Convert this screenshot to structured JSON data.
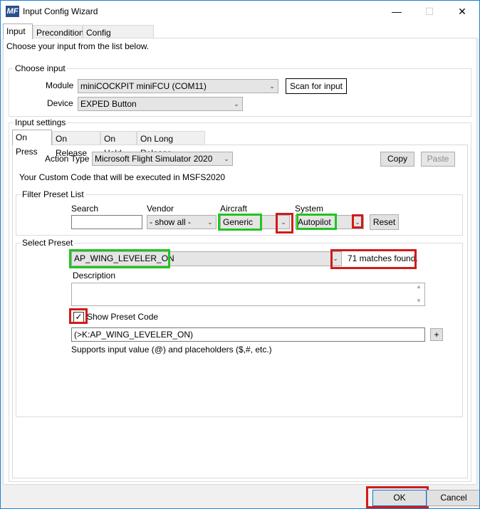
{
  "window": {
    "title": "Input Config Wizard",
    "logo_text": "MF",
    "minimize": "—",
    "maximize": "☐",
    "close": "✕"
  },
  "tabs": [
    {
      "label": "Input"
    },
    {
      "label": "Precondition"
    },
    {
      "label": "Config References"
    }
  ],
  "intro_text": "Choose your input from the list below.",
  "choose_input": {
    "legend": "Choose input",
    "module_label": "Module",
    "module_value": "miniCOCKPIT miniFCU (COM11)",
    "device_label": "Device",
    "device_value": "EXPED Button",
    "scan_button": "Scan for input"
  },
  "input_settings": {
    "legend": "Input settings",
    "subtabs": [
      {
        "label": "On Press"
      },
      {
        "label": "On Release"
      },
      {
        "label": "On Hold"
      },
      {
        "label": "On Long Release"
      }
    ],
    "action_type_label": "Action Type",
    "action_type_value": "Microsoft Flight Simulator 2020",
    "copy_button": "Copy",
    "paste_button": "Paste",
    "custom_code_text": "Your Custom Code that will be executed in MSFS2020"
  },
  "filter": {
    "legend": "Filter Preset List",
    "search_label": "Search",
    "search_value": "",
    "vendor_label": "Vendor",
    "vendor_value": "- show all -",
    "aircraft_label": "Aircraft",
    "aircraft_value": "Generic",
    "system_label": "System",
    "system_value": "Autopilot",
    "reset_button": "Reset"
  },
  "preset": {
    "legend": "Select Preset",
    "preset_value": "AP_WING_LEVELER_ON",
    "matches_text": "71 matches found.",
    "description_label": "Description",
    "description_value": "",
    "show_code_label": "Show Preset Code",
    "show_code_checked": true,
    "code_value": "(>K:AP_WING_LEVELER_ON)",
    "plus_button": "+",
    "hint_text": "Supports input value (@) and placeholders ($,#, etc.)"
  },
  "footer": {
    "ok_button": "OK",
    "cancel_button": "Cancel"
  },
  "colors": {
    "highlight_green": "#22c322",
    "highlight_red": "#d11a1a",
    "accent": "#1883d7"
  }
}
